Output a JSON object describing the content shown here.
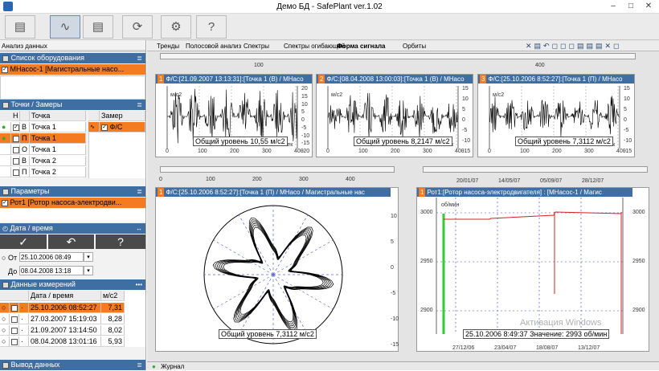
{
  "window": {
    "title": "Демо БД - SafePlant ver.1.02"
  },
  "toolbar": {
    "buttons": [
      {
        "name": "hardware-icon"
      },
      {
        "name": "analysis-icon"
      },
      {
        "name": "report-icon"
      },
      {
        "name": "sync-icon"
      },
      {
        "name": "gear-icon"
      },
      {
        "name": "help-icon"
      }
    ]
  },
  "left": {
    "title": "Анализ данных",
    "equipment": {
      "header": "Список оборудования",
      "item": "МНасос-1 [Магистральные насо..."
    },
    "points": {
      "header": "Точки / Замеры",
      "col_n": "Н",
      "col_point": "Точка",
      "col_measure": "Замер",
      "measure_item": "Ф/С",
      "rows": [
        {
          "dir": "В",
          "name": "Точка 1",
          "checked": true,
          "dot": "green",
          "sel": false
        },
        {
          "dir": "П",
          "name": "Точка 1",
          "checked": false,
          "dot": "green",
          "sel": true
        },
        {
          "dir": "О",
          "name": "Точка 1",
          "checked": false,
          "dot": "",
          "sel": false
        },
        {
          "dir": "В",
          "name": "Точка 2",
          "checked": false,
          "dot": "",
          "sel": false
        },
        {
          "dir": "П",
          "name": "Точка 2",
          "checked": false,
          "dot": "",
          "sel": false
        }
      ]
    },
    "params": {
      "header": "Параметры",
      "item": "Рот1 [Ротор насоса-электродви..."
    },
    "datetime": {
      "header": "Дата / время",
      "from_label": "От",
      "from": "25.10.2006 08:49",
      "to_label": "До",
      "to": "08.04.2008 13:18"
    },
    "measurements": {
      "header": "Данные измерений",
      "col_date": "Дата / время",
      "col_unit": "м/с2",
      "rows": [
        {
          "date": "25.10.2006 08:52:27",
          "value": "7,31",
          "sel": true
        },
        {
          "date": "27.03.2007 15:19:03",
          "value": "8,28",
          "sel": false
        },
        {
          "date": "21.09.2007 13:14:50",
          "value": "8,02",
          "sel": false
        },
        {
          "date": "08.04.2008 13:01:16",
          "value": "5,93",
          "sel": false
        }
      ]
    },
    "output": {
      "header": "Вывод данных"
    }
  },
  "tabs": [
    "Тренды",
    "Полосовой анализ",
    "Спектры",
    "Спектры огибающей",
    "Форма сигнала",
    "Орбиты"
  ],
  "active_tab": "Форма сигнала",
  "waves": [
    {
      "num": "1",
      "header": "Ф/С:[21.09.2007 13:13:31]:[Точка 1 (В) / МНасо",
      "level": "Общий уровень 10,55 м/с2",
      "unit": "м/с2",
      "xunit": "мсек",
      "yt": [
        "20",
        "15",
        "10",
        "5",
        "0",
        "-5",
        "-10",
        "-15",
        "-20"
      ],
      "xt": [
        "0",
        "100",
        "200",
        "300",
        "400"
      ]
    },
    {
      "num": "2",
      "header": "Ф/С:[08.04.2008 13:00:03]:[Точка 1 (В) / МНасо",
      "level": "Общий уровень 8,2147 м/с2",
      "unit": "м/с2",
      "xunit": "мсек",
      "yt": [
        "15",
        "10",
        "5",
        "0",
        "-5",
        "-10",
        "-15"
      ],
      "xt": [
        "0",
        "100",
        "200",
        "300",
        "400"
      ]
    },
    {
      "num": "3",
      "header": "Ф/С:[25.10.2006 8:52:27]:[Точка 1 (П) / МНасо",
      "level": "Общий уровень 7,3112 м/с2",
      "unit": "м/с2",
      "xunit": "мсек",
      "yt": [
        "15",
        "10",
        "5",
        "0",
        "-5",
        "-10",
        "-15"
      ],
      "xt": [
        "0",
        "100",
        "200",
        "300",
        "400"
      ]
    }
  ],
  "top_scale": {
    "t1": "100",
    "t2": "400"
  },
  "polar": {
    "num": "1",
    "header": "Ф/С:[25.10.2006 8:52:27]:[Точка 1 (П) / МНасо / Магистральные нас",
    "level": "Общий уровень 7,3112 м/с2",
    "xt": [
      "0",
      "100",
      "200",
      "300",
      "400"
    ],
    "yt": [
      "10",
      "5",
      "0",
      "-5",
      "-10",
      "-15"
    ]
  },
  "trend": {
    "num": "1",
    "header": "Рот1:[Ротор насоса-электродвигателя] : [МНасос-1 / Магис",
    "ylabel": "об/мин",
    "value_label": "25.10.2006 8:49:37 Значение: 2993 об/мин",
    "dates_top": [
      "20/01/07",
      "14/05/07",
      "05/09/07",
      "28/12/07"
    ],
    "dates_bottom": [
      "27/12/06",
      "23/04/07",
      "18/08/07",
      "13/12/07"
    ],
    "yl": [
      "3000",
      "2950",
      "2900"
    ],
    "watermark": "Активация Windows"
  },
  "status": {
    "journal": "Журнал"
  },
  "colors": {
    "accent": "#3f6ea3",
    "selection": "#f47b20",
    "trend": "#d42020",
    "marker": "#33cc33"
  }
}
